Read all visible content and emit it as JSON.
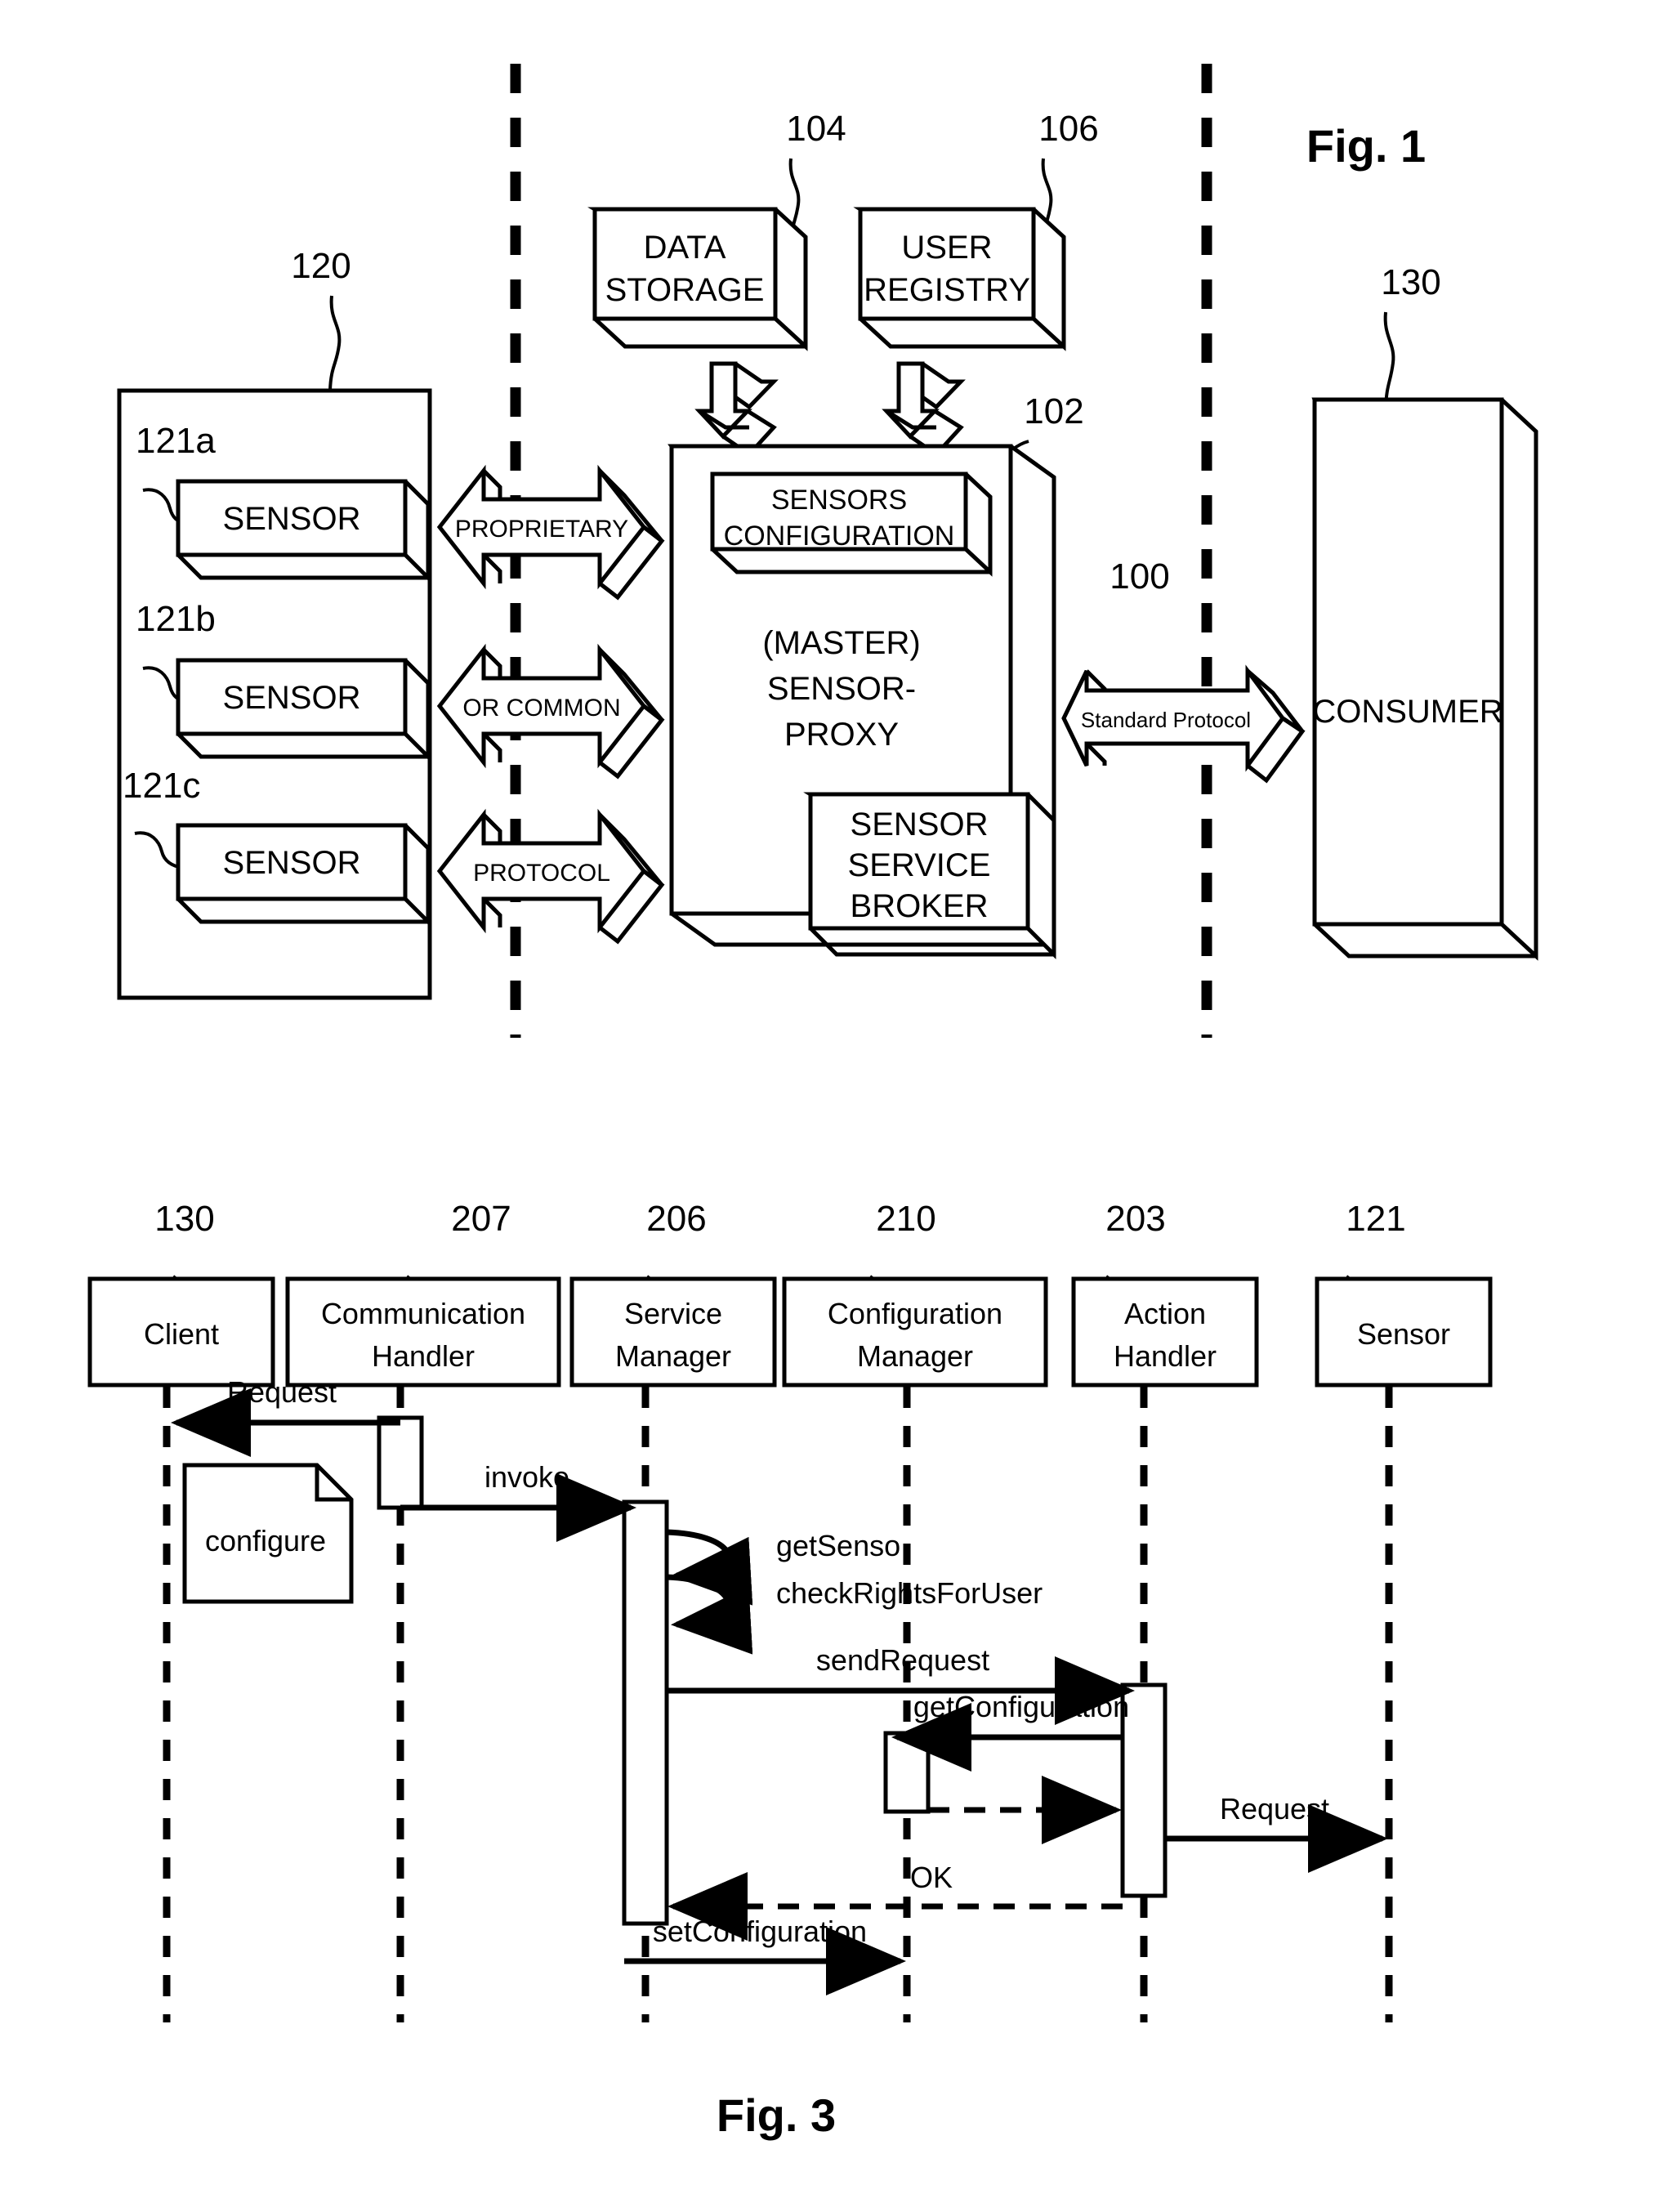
{
  "figure1": {
    "title": "Fig. 1",
    "refs": {
      "sensors_group": "120",
      "sensor_a": "121a",
      "sensor_b": "121b",
      "sensor_c": "121c",
      "data_storage": "104",
      "user_registry": "106",
      "proxy": "102",
      "boundary": "100",
      "consumer": "130"
    },
    "blocks": {
      "data_storage_line1": "DATA",
      "data_storage_line2": "STORAGE",
      "user_registry_line1": "USER",
      "user_registry_line2": "REGISTRY",
      "sensors_config_line1": "SENSORS",
      "sensors_config_line2": "CONFIGURATION",
      "proxy_line1": "(MASTER)",
      "proxy_line2": "SENSOR-",
      "proxy_line3": "PROXY",
      "broker_line1": "SENSOR",
      "broker_line2": "SERVICE",
      "broker_line3": "BROKER",
      "sensor_a_label": "SENSOR",
      "sensor_b_label": "SENSOR",
      "sensor_c_label": "SENSOR",
      "consumer_label": "CONSUMER"
    },
    "arrows": {
      "proprietary": "PROPRIETARY",
      "or_common": "OR COMMON",
      "protocol": "PROTOCOL",
      "standard_protocol": "Standard Protocol"
    }
  },
  "figure3": {
    "title": "Fig. 3",
    "lifelines": [
      {
        "ref": "130",
        "label_line1": "Client",
        "label_line2": ""
      },
      {
        "ref": "207",
        "label_line1": "Communication",
        "label_line2": "Handler"
      },
      {
        "ref": "206",
        "label_line1": "Service",
        "label_line2": "Manager"
      },
      {
        "ref": "210",
        "label_line1": "Configuration",
        "label_line2": "Manager"
      },
      {
        "ref": "203",
        "label_line1": "Action",
        "label_line2": "Handler"
      },
      {
        "ref": "121",
        "label_line1": "Sensor",
        "label_line2": ""
      }
    ],
    "note": "configure",
    "messages": [
      {
        "label": "Request"
      },
      {
        "label": "invoke"
      },
      {
        "label": "getSenso"
      },
      {
        "label": "checkRightsForUser"
      },
      {
        "label": "sendRequest"
      },
      {
        "label": "getConfiguration"
      },
      {
        "label": "Request"
      },
      {
        "label": "OK"
      },
      {
        "label": "setConfiguration"
      }
    ]
  }
}
